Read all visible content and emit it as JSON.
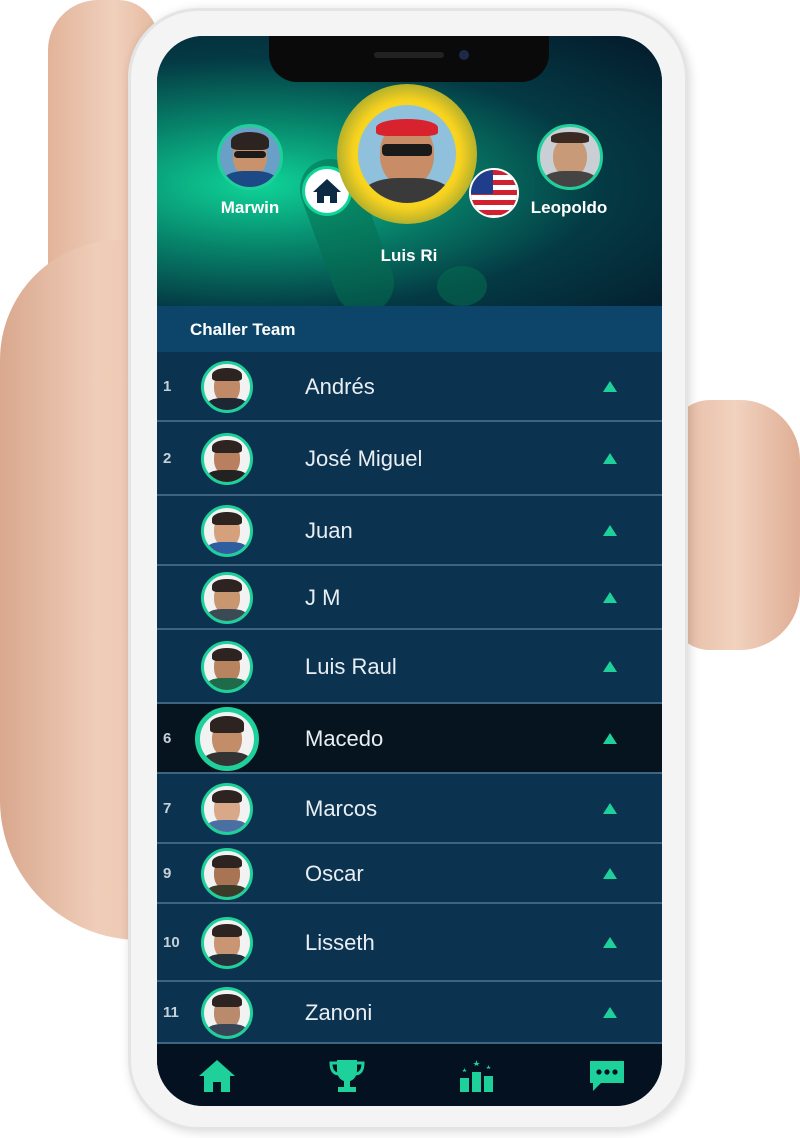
{
  "header": {
    "left_player": {
      "name": "Marwin"
    },
    "center_player": {
      "name": "Luis Ri"
    },
    "right_player": {
      "name": "Leopoldo"
    },
    "home_icon": "home-icon",
    "flag_icon": "us-flag-icon"
  },
  "team": {
    "title": "Challer Team"
  },
  "rows": [
    {
      "rank": "1",
      "name": "Andrés"
    },
    {
      "rank": "2",
      "name": "José Miguel"
    },
    {
      "rank": "",
      "name": "Juan"
    },
    {
      "rank": "",
      "name": "J M"
    },
    {
      "rank": "",
      "name": "Luis Raul"
    },
    {
      "rank": "6",
      "name": "Macedo"
    },
    {
      "rank": "7",
      "name": "Marcos"
    },
    {
      "rank": "9",
      "name": "Oscar"
    },
    {
      "rank": "10",
      "name": "Lisseth"
    },
    {
      "rank": "11",
      "name": "Zanoni"
    }
  ],
  "nav": {
    "items": [
      "home-icon",
      "trophy-icon",
      "ranking-icon",
      "chat-icon"
    ],
    "accent": "#1ed19b"
  },
  "colors": {
    "accent": "#1ed19b",
    "row_bg": "#0b3350",
    "active_row_bg": "#05141f",
    "team_bar": "#0c4569",
    "center_ring": "#f2c417"
  }
}
